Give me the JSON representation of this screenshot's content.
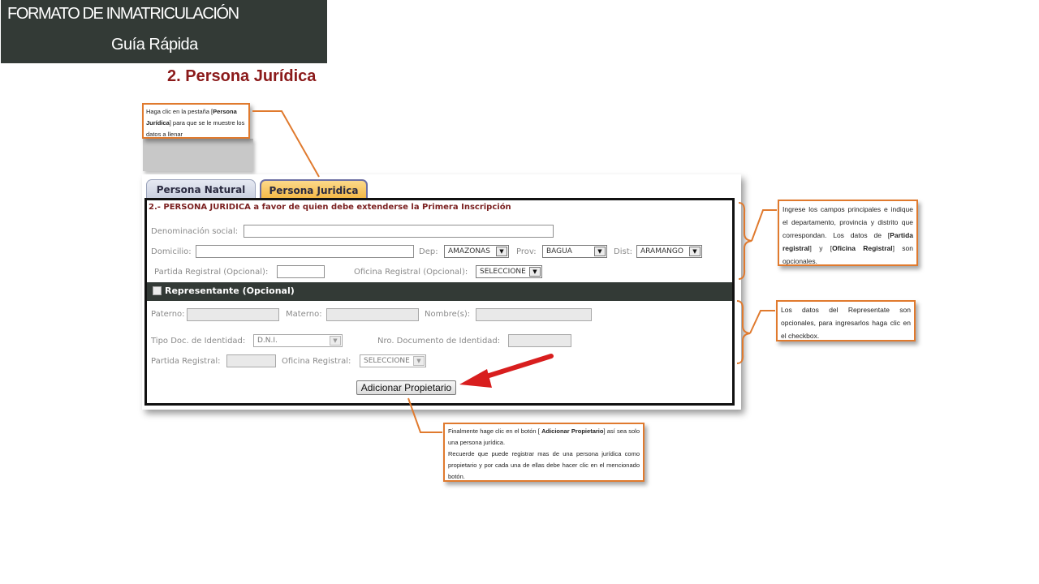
{
  "header": {
    "title": "FORMATO DE INMATRICULACIÓN",
    "subtitle": "Guía Rápida"
  },
  "section_title": "2. Persona Jurídica",
  "callouts": {
    "tab_hint": {
      "t1": "Haga clic en la pestaña [",
      "b1": "Persona Jurídica",
      "t2": "] para que se le muestre los datos a llenar"
    },
    "main_fields_hint": {
      "t1": "Ingrese los campos principales e indique el departamento, provincia y distrito que correspondan. Los datos de [",
      "b1": "Partida registral",
      "t2": "] y [",
      "b2": "Oficina Registral",
      "t3": "] son opcionales."
    },
    "representative_hint": {
      "t1": "Los datos del Representate son opcionales, para ingresarlos haga clic en el checkbox."
    },
    "add_owner_hint": {
      "t1": "Finalmente hage clic en el botón [ ",
      "b1": "Adicionar Propietario",
      "t2": "] así sea solo una persona jurídica.",
      "t3": "Recuerde que puede registrar mas de una persona jurídica como propietario y por cada una de ellas debe hacer clic en el mencionado botón."
    }
  },
  "form": {
    "tabs": [
      {
        "label": "Persona Natural",
        "active": false
      },
      {
        "label": "Persona Juridica",
        "active": true
      }
    ],
    "panel_title": "2.- PERSONA JURIDICA a favor de quien debe extenderse la Primera Inscripción",
    "fields": {
      "denominacion_label": "Denominación social:",
      "domicilio_label": "Domicilio:",
      "dep_label": "Dep:",
      "dep_value": "AMAZONAS",
      "prov_label": "Prov:",
      "prov_value": "BAGUA",
      "dist_label": "Dist:",
      "dist_value": "ARAMANGO",
      "partida_label": "Partida Registral (Opcional):",
      "oficina_label": "Oficina Registral (Opcional):",
      "oficina_value": "SELECCIONE"
    },
    "representante": {
      "label": "Representante (Opcional)",
      "paterno_label": "Paterno:",
      "materno_label": "Materno:",
      "nombres_label": "Nombre(s):",
      "tipo_doc_label": "Tipo Doc. de Identidad:",
      "tipo_doc_value": "D.N.I.",
      "nro_doc_label": "Nro. Documento de Identidad:",
      "partida_label": "Partida Registral:",
      "oficina_label": "Oficina Registral:",
      "oficina_value": "SELECCIONE"
    },
    "add_button": "Adicionar Propietario"
  },
  "colors": {
    "header_bg": "#333a36",
    "title_red": "#8b1a1a",
    "callout_border": "#e07a2e",
    "arrow_red": "#d81e1e"
  }
}
